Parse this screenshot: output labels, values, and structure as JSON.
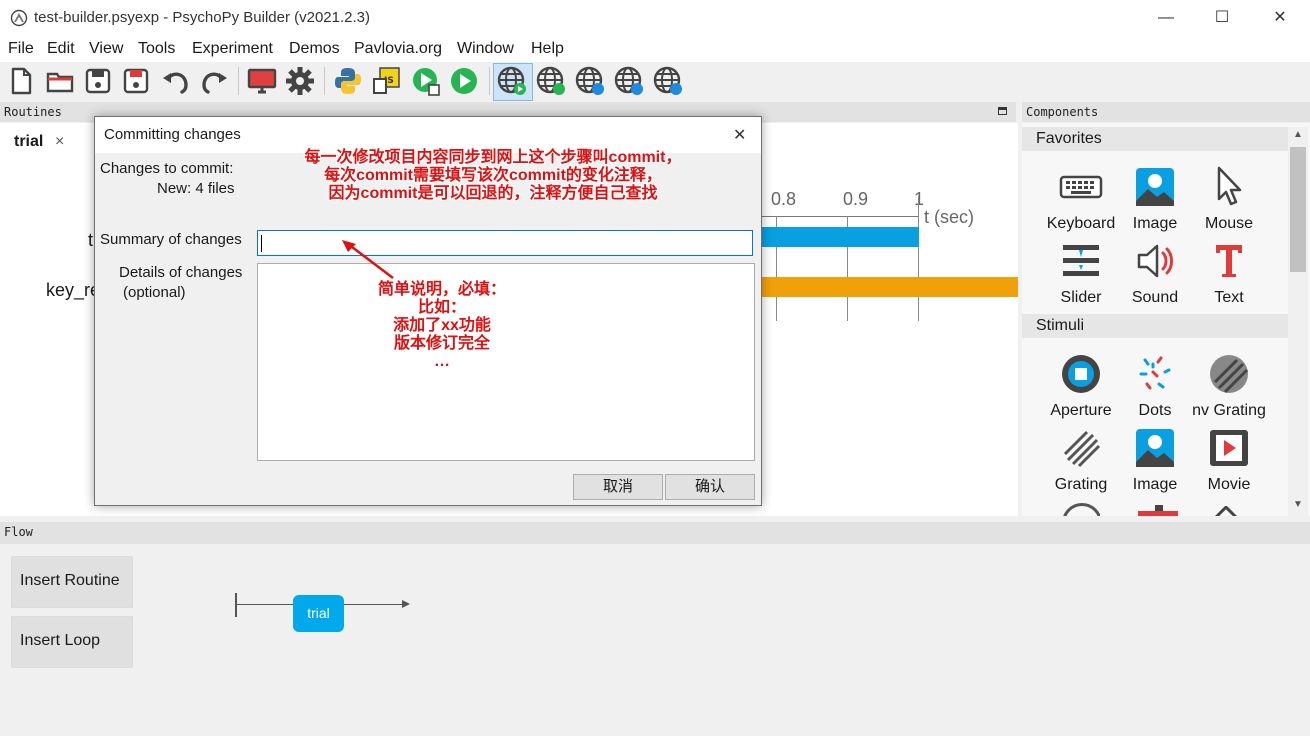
{
  "window": {
    "title": "test-builder.psyexp - PsychoPy Builder (v2021.2.3)",
    "minimize": "—",
    "maximize": "☐",
    "close": "✕"
  },
  "menu": [
    "File",
    "Edit",
    "View",
    "Tools",
    "Experiment",
    "Demos",
    "Pavlovia.org",
    "Window",
    "Help"
  ],
  "routines": {
    "header": "Routines",
    "tab": "trial",
    "tab_close": "×",
    "row_label_1": "t",
    "row_label_2": "key_re",
    "timeline_ticks": [
      "0.8",
      "0.9",
      "1"
    ],
    "timeline_unit": "t (sec)"
  },
  "components": {
    "header": "Components",
    "categories": [
      {
        "name": "Favorites",
        "items": [
          "Keyboard",
          "Image",
          "Mouse",
          "Slider",
          "Sound",
          "Text"
        ]
      },
      {
        "name": "Stimuli",
        "items": [
          "Aperture",
          "Dots",
          "nv Grating",
          "Grating",
          "Image",
          "Movie"
        ]
      }
    ]
  },
  "flow": {
    "header": "Flow",
    "insert_routine": "Insert Routine",
    "insert_loop": "Insert Loop",
    "routine_node": "trial"
  },
  "dialog": {
    "title": "Committing changes",
    "close": "✕",
    "changes_label": "Changes to commit:",
    "changes_value": "New: 4 files",
    "summary_label": "Summary of changes",
    "summary_value": "",
    "details_label_1": "Details of changes",
    "details_label_2": "(optional)",
    "cancel": "取消",
    "ok": "确认"
  },
  "annotations": {
    "top_1": "每一次修改项目内容同步到网上这个步骤叫commit，",
    "top_2": "每次commit需要填写该次commit的变化注释，",
    "top_3": "因为commit是可以回退的，注释方便自己查找",
    "mid_1": "简单说明，必填：",
    "mid_2": "比如：",
    "mid_3": "添加了xx功能",
    "mid_4": "版本修订完全",
    "mid_5": "…"
  },
  "colors": {
    "accent_blue": "#0a9fe0",
    "bar_orange": "#f0a10a",
    "annotation_red": "#dd1111",
    "flow_node": "#02a9ea"
  }
}
